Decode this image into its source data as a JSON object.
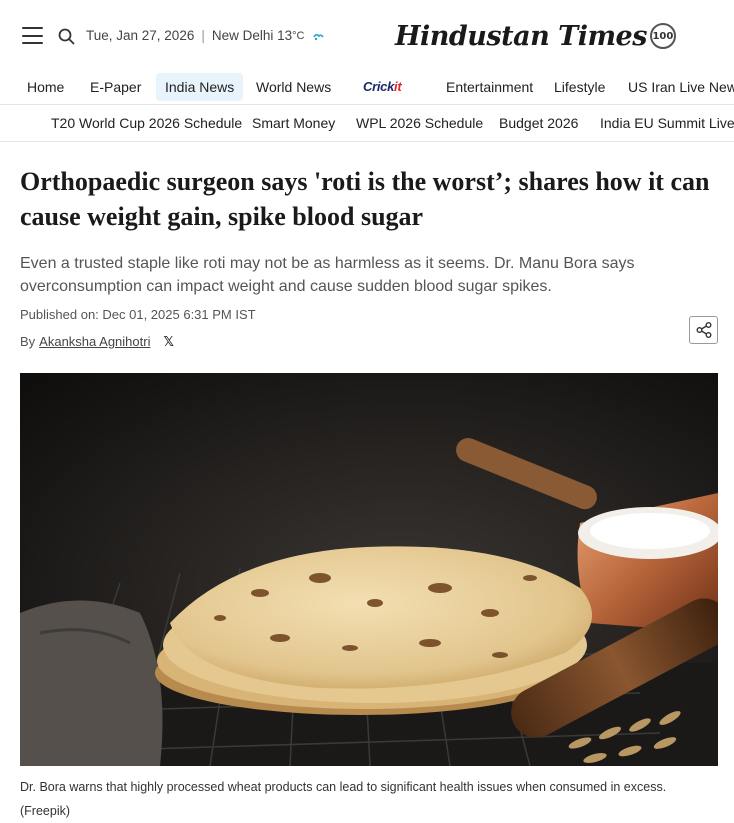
{
  "header": {
    "date": "Tue, Jan 27, 2026",
    "location_weather": "New Delhi 13",
    "temp_unit": "°C",
    "logo_text": "Hindustan Times",
    "logo_badge": "100"
  },
  "main_nav": {
    "items": [
      {
        "label": "Home"
      },
      {
        "label": "E-Paper"
      },
      {
        "label": "India News",
        "active": true
      },
      {
        "label": "World News"
      },
      {
        "label": "Entertainment"
      },
      {
        "label": "Lifestyle"
      },
      {
        "label": "US Iran Live News"
      }
    ],
    "cricket_logo": {
      "main": "Crick",
      "accent": "it"
    }
  },
  "sub_nav": {
    "items": [
      {
        "label": "T20 World Cup 2026 Schedule"
      },
      {
        "label": "Smart Money"
      },
      {
        "label": "WPL 2026 Schedule"
      },
      {
        "label": "Budget 2026"
      },
      {
        "label": "India EU Summit Live"
      }
    ]
  },
  "article": {
    "headline": "Orthopaedic surgeon says 'roti is the worst’; shares how it can cause weight gain, spike blood sugar",
    "summary": "Even a trusted staple like roti may not be as harmless as it seems. Dr. Manu Bora says overconsumption can impact weight and cause sudden blood sugar spikes.",
    "published": "Published on: Dec 01, 2025 6:31 PM IST",
    "by_prefix": "By",
    "author": "Akanksha Agnihotri",
    "image_caption": "Dr. Bora warns that highly processed wheat products can lead to significant health issues when consumed in excess. (Freepik)"
  },
  "colors": {
    "active_nav_bg": "#e8f4fb",
    "headline": "#1a1a1a",
    "summary": "#555555",
    "cricket_brand": "#1a2a6c",
    "cricket_accent": "#e0282e"
  },
  "icons": [
    "hamburger-menu-icon",
    "search-icon",
    "weather-icon",
    "x-twitter-icon",
    "share-icon"
  ]
}
